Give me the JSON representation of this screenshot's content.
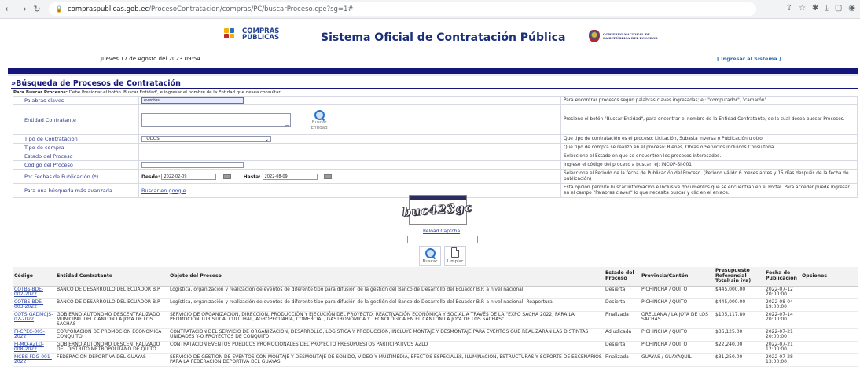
{
  "browser": {
    "url_domain": "compraspublicas.gob.ec",
    "url_path": "/ProcesoContratacion/compras/PC/buscarProceso.cpe?sg=1#"
  },
  "header": {
    "logo_line1": "COMPRAS",
    "logo_line2": "PÚBLICAS",
    "title": "Sistema Oficial de Contratación Pública",
    "gov_line1": "GOBIERNO NACIONAL DE",
    "gov_line2": "LA REPÚBLICA DEL ECUADOR",
    "date": "Jueves 17 de Agosto del 2023 09:54",
    "login": "[ Ingresar al Sistema ]"
  },
  "search": {
    "title": "»Búsqueda de Procesos de Contratación",
    "hint_bold": "Para Buscar Procesos:",
    "hint_text": " Debe Presionar el botón 'Buscar Entidad', e ingresar el nombre de la Entidad que desea consultar.",
    "keywords_label": "Palabras claves",
    "keywords_value": "eventos",
    "keywords_help": "Para encontrar procesos según palabras claves ingresadas; ej: \"computador\", \"camarón\".",
    "entity_label": "Entidad Contratante",
    "entity_button": "Buscar Entidad",
    "entity_help": "Presione el botón \"Buscar Entidad\", para encontrar el nombre de la Entidad Contratante, de la cual desea buscar Procesos.",
    "type_label": "Tipo de Contratación",
    "type_value": "TODOS",
    "type_help": "Que tipo de contratación es el proceso: Licitación, Subasta Inversa o Publicación u otro.",
    "purchase_label": "Tipo de compra",
    "purchase_help": "Qué tipo de compra se realizó en el proceso: Bienes, Obras o Servicios incluidos Consultoría",
    "state_label": "Estado del Proceso",
    "state_help": "Seleccione el Estado en que se encuentren los procesos interesados.",
    "code_label": "Código del Proceso",
    "code_help": "Ingrese el código del proceso a buscar, ej: INCOP-SI-001",
    "dates_label": "Por Fechas de Publicación (*)",
    "from_label": "Desde:",
    "from_value": "2022-02-09",
    "to_label": "Hasta:",
    "to_value": "2022-08-09",
    "dates_help": "Seleccione el Periodo de la fecha de Publicación del Proceso. (Periodo válido 6 meses antes y 15 días después de la fecha de publicación)",
    "advanced_label": "Para una búsqueda más avanzada",
    "advanced_link": "Buscar en google",
    "advanced_help": "Esta opción permite buscar información e inclusive documentos que se encuentran en el Portal. Para acceder puede ingresar en el campo \"Palabras claves\" lo que necesita buscar y clic en el enlace."
  },
  "captcha": {
    "text": "buc423gc",
    "reload": "Reload Captcha",
    "search_button": "Buscar",
    "clear_button": "Limpiar"
  },
  "results": {
    "headers": [
      "Código",
      "Entidad Contratante",
      "Objeto del Proceso",
      "Estado del Proceso",
      "Provincia/Cantón",
      "Presupuesto Referencial Total(sin iva)",
      "Fecha de Publicación",
      "Opciones"
    ],
    "rows": [
      [
        "COTBS-BDE-002-2022",
        "BANCO DE DESARROLLO DEL ECUADOR B.P.",
        "Logística, organización y realización de eventos de diferente tipo para difusión de la gestión del Banco de Desarrollo del Ecuador B.P. a nivel nacional",
        "Desierta",
        "PICHINCHA / QUITO",
        "$445,000.00",
        "2022-07-12 20:00:00"
      ],
      [
        "COTBS-BDE-003-2022",
        "BANCO DE DESARROLLO DEL ECUADOR B.P.",
        "Logística, organización y realización de eventos de diferente tipo para difusión de la gestión del Banco de Desarrollo del Ecuador B.P. a nivel nacional. Reapertura",
        "Desierta",
        "PICHINCHA / QUITO",
        "$445,000.00",
        "2022-08-04 19:00:00"
      ],
      [
        "COTS-GADMCJS-02-2022",
        "GOBIERNO AUTONOMO DESCENTRALIZADO MUNICIPAL DEL CANTON LA JOYA DE LOS SACHAS",
        "SERVICIO DE ORGANIZACIÓN, DIRECCIÓN, PRODUCCIÓN Y EJECUCIÓN DEL PROYECTO: REACTIVACIÓN ECONÓMICA Y SOCIAL A TRAVÉS DE LA \"EXPO SACHA 2022, PARA LA PROMOCIÓN TURÍSTICA, CULTURAL, AGROPECUARIA, COMERCIAL, GASTRONÓMICA Y TECNOLÓGICA EN EL CANTÓN LA JOYA DE LOS SACHAS\".",
        "Finalizada",
        "ORELLANA / LA JOYA DE LOS SACHAS",
        "$105,117.80",
        "2022-07-14 20:00:00"
      ],
      [
        "FI-CPEC-005-2022",
        "CORPORACION DE PROMOCION ECONOMICA CONQUITO",
        "CONTRATACION DEL SERVICIO DE ORGANIZACION, DESARROLLO, LOGISTICA Y PRODUCCION, INCLUYE MONTAJE Y DESMONTAJE PARA EVENTOS QUE REALIZARAN LAS DISTINTAS UNIDADES Y-O PROYECTOS DE CONQUITO",
        "Adjudicada",
        "PICHINCHA / QUITO",
        "$36,125.00",
        "2022-07-21 20:00:00"
      ],
      [
        "FI-MO-AZLD-008-2022",
        "GOBIERNO AUTONOMO DESCENTRALIZADO DEL DISTRITO METROPOLITANO DE QUITO",
        "CONTRATACION EVENTOS PUBLICOS PROMOCIONALES DEL PROYECTO PRESUPUESTOS PARTICIPATIVOS AZLD",
        "Desierta",
        "PICHINCHA / QUITO",
        "$22,240.00",
        "2022-07-21 12:00:00"
      ],
      [
        "MCBS-FDG-001-2022",
        "FEDERACION DEPORTIVA DEL GUAYAS",
        "SERVICIO DE GESTION DE EVENTOS CON MONTAJE Y DESMONTAJE DE SONIDO, VIDEO Y MULTIMEDIA, EFECTOS ESPECIALES, ILUMINACION, ESTRUCTURAS Y SOPORTE DE ESCENARIOS PARA LA FEDERACION DEPORTIVA DEL GUAYAS",
        "Finalizada",
        "GUAYAS / GUAYAQUIL",
        "$31,250.00",
        "2022-07-28 13:00:00"
      ]
    ]
  },
  "colors": {
    "navy": "#14167a",
    "link": "#2b46a8",
    "title_blue": "#1b2f7a"
  }
}
